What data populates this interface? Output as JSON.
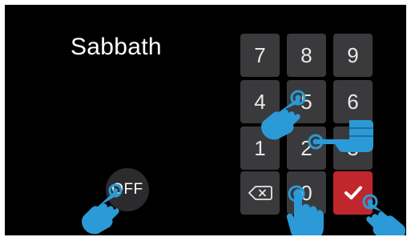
{
  "mode": {
    "title": "Sabbath"
  },
  "toggle": {
    "label": "OFF"
  },
  "keypad": {
    "keys": [
      "7",
      "8",
      "9",
      "4",
      "5",
      "6",
      "1",
      "2",
      "3",
      "0"
    ],
    "backspace_icon": "backspace-icon",
    "enter_icon": "checkmark-icon"
  },
  "colors": {
    "screen_background": "#000000",
    "key_background": "#3a3a3c",
    "enter_key": "#c0272d",
    "toggle_background": "#2b2b2d",
    "gesture_hand": "#2b9ad6"
  },
  "gesture_icons": [
    "tap-hand-icon",
    "swipe-hand-icon"
  ]
}
